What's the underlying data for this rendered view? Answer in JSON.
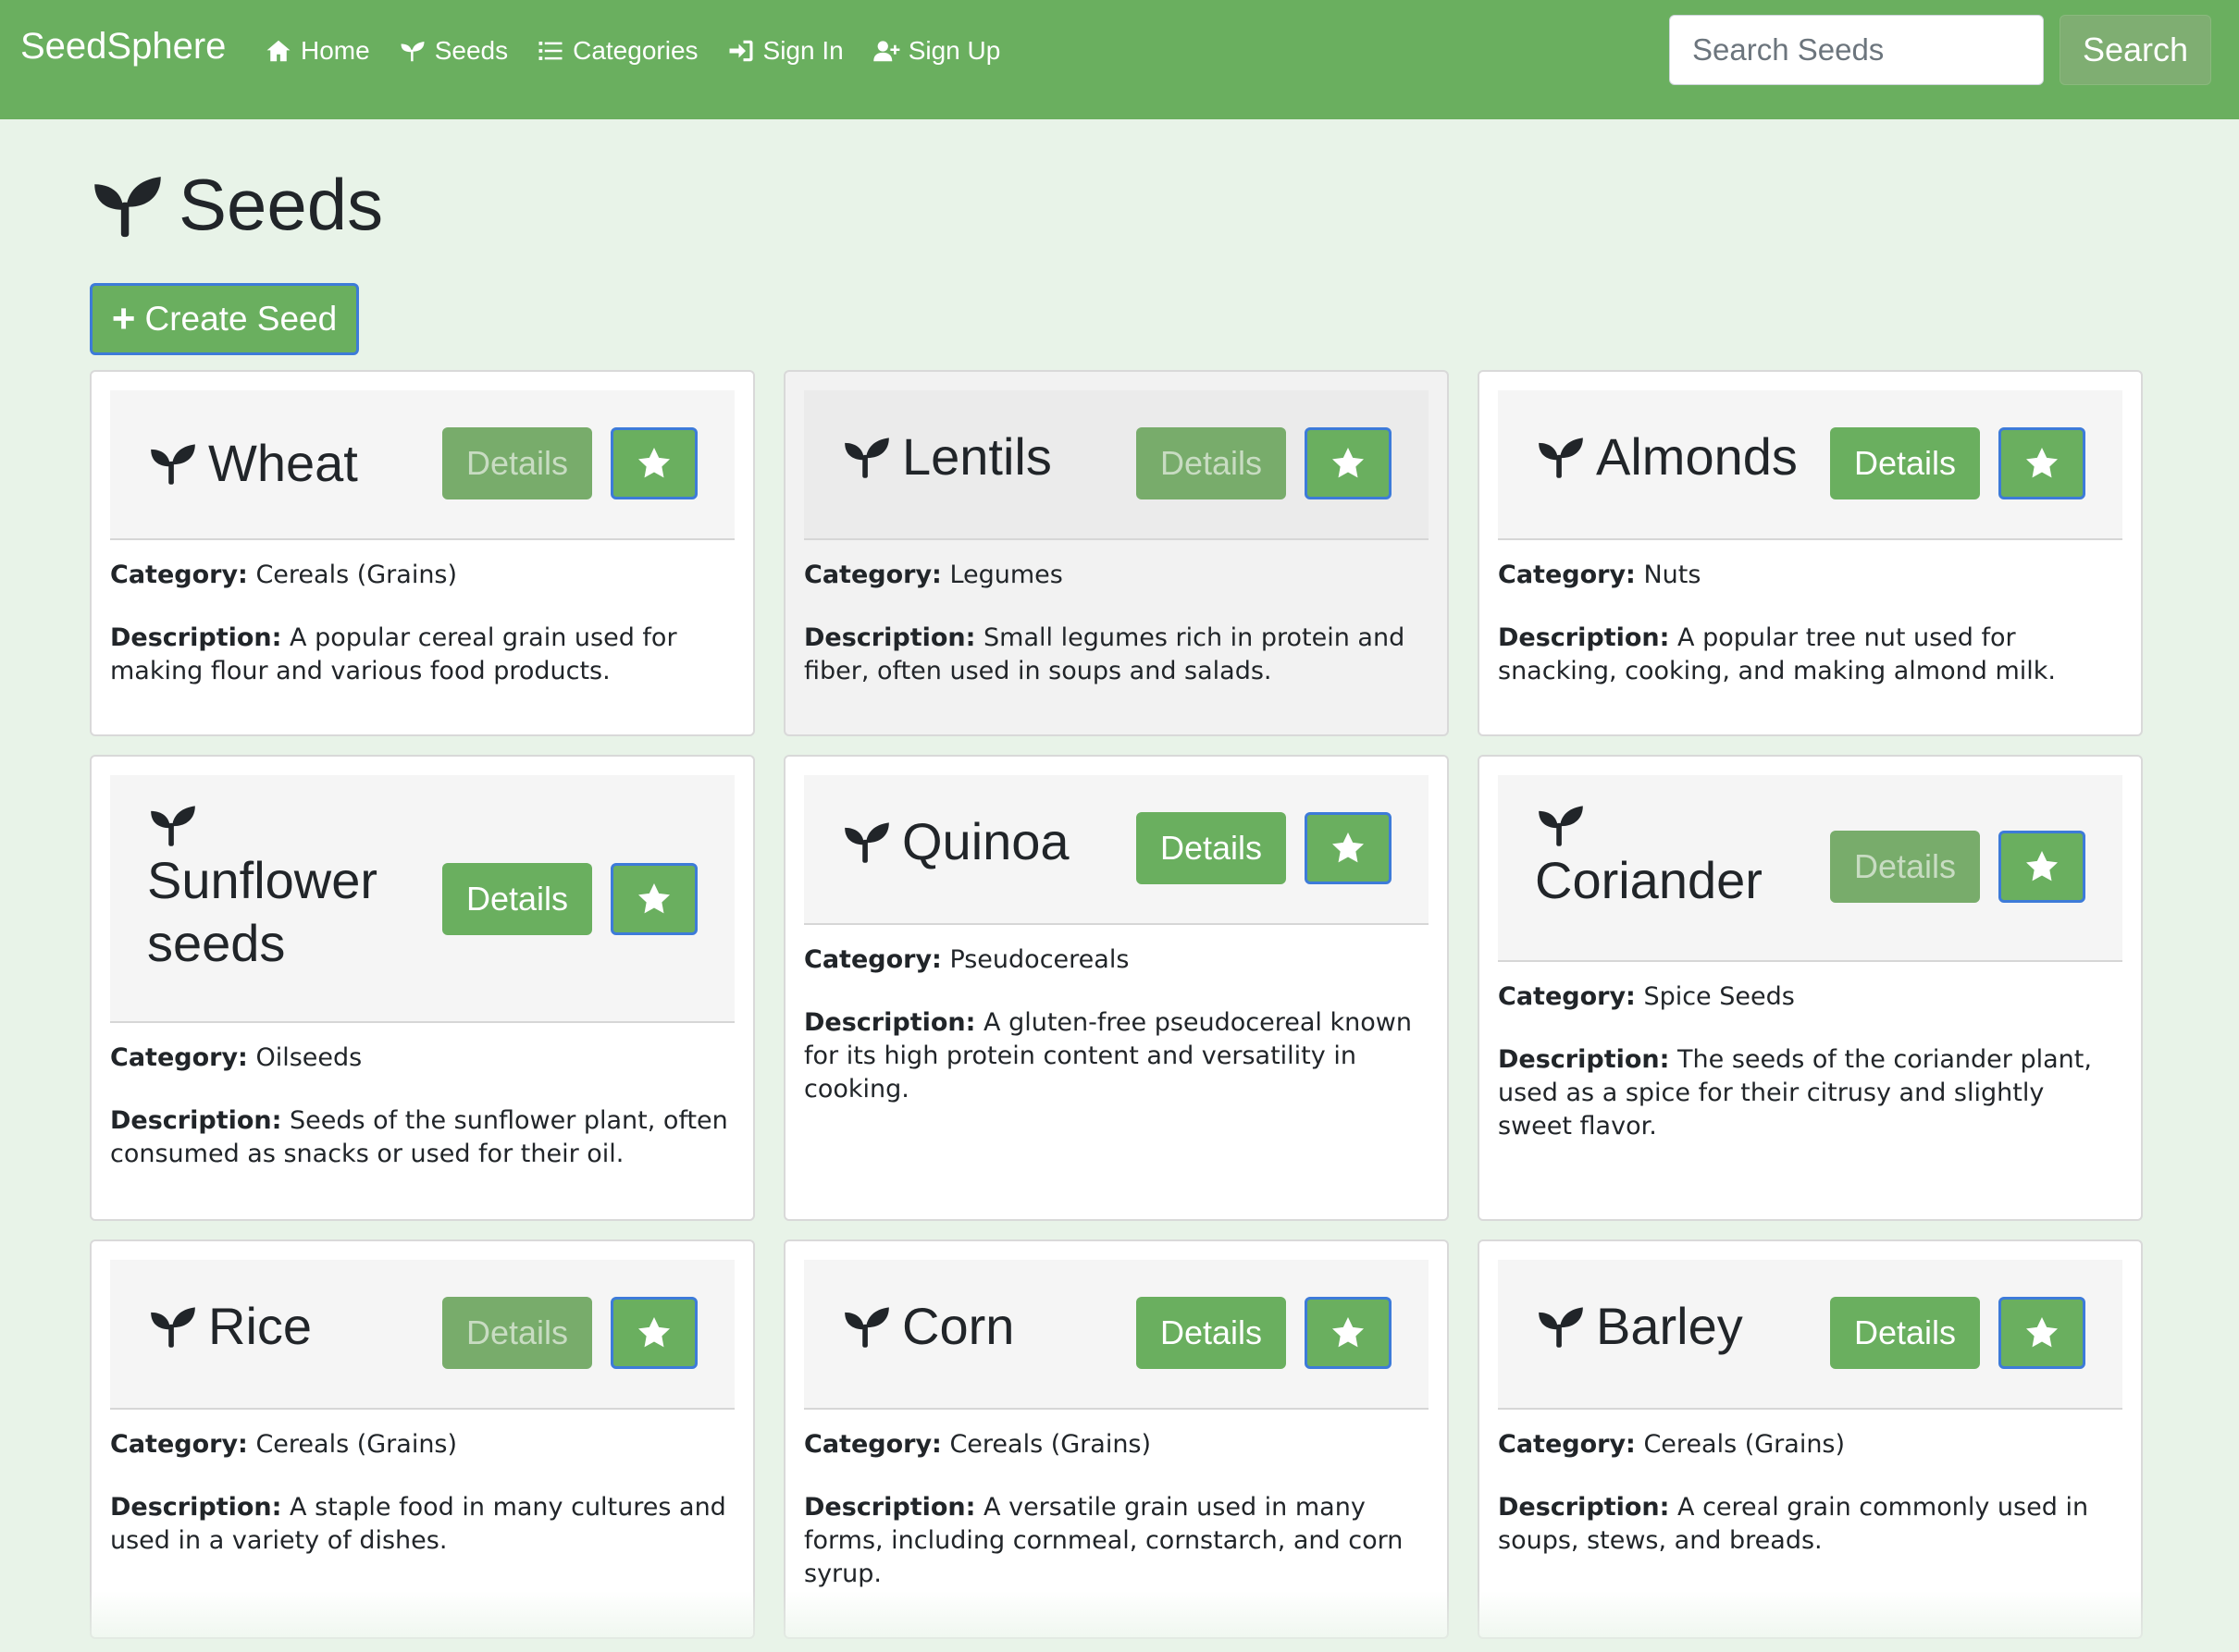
{
  "navbar": {
    "brand": "SeedSphere",
    "links": [
      {
        "label": "Home",
        "icon": "home-icon"
      },
      {
        "label": "Seeds",
        "icon": "seedling-icon"
      },
      {
        "label": "Categories",
        "icon": "list-icon"
      },
      {
        "label": "Sign In",
        "icon": "sign-in-icon"
      },
      {
        "label": "Sign Up",
        "icon": "user-plus-icon"
      }
    ],
    "search_placeholder": "Search Seeds",
    "search_button": "Search"
  },
  "page": {
    "title": "Seeds",
    "title_icon": "seedling-icon",
    "create_button": "Create Seed"
  },
  "labels": {
    "category": "Category:",
    "description": "Description:",
    "details": "Details"
  },
  "colors": {
    "navbar": "#6aaf5f",
    "background": "#e8f3e8",
    "button": "#6aaf5f",
    "focus_border": "#3d7bd9"
  },
  "seeds": [
    {
      "name": "Wheat",
      "category": "Cereals (Grains)",
      "description": "A popular cereal grain used for making flour and various food products."
    },
    {
      "name": "Lentils",
      "category": "Legumes",
      "description": "Small legumes rich in protein and fiber, often used in soups and salads."
    },
    {
      "name": "Almonds",
      "category": "Nuts",
      "description": "A popular tree nut used for snacking, cooking, and making almond milk."
    },
    {
      "name": "Sunflower seeds",
      "category": "Oilseeds",
      "description": "Seeds of the sunflower plant, often consumed as snacks or used for their oil."
    },
    {
      "name": "Quinoa",
      "category": "Pseudocereals",
      "description": "A gluten-free pseudocereal known for its high protein content and versatility in cooking."
    },
    {
      "name": "Coriander",
      "category": "Spice Seeds",
      "description": "The seeds of the coriander plant, used as a spice for their citrusy and slightly sweet flavor."
    },
    {
      "name": "Rice",
      "category": "Cereals (Grains)",
      "description": "A staple food in many cultures and used in a variety of dishes."
    },
    {
      "name": "Corn",
      "category": "Cereals (Grains)",
      "description": "A versatile grain used in many forms, including cornmeal, cornstarch, and corn syrup."
    },
    {
      "name": "Barley",
      "category": "Cereals (Grains)",
      "description": "A cereal grain commonly used in soups, stews, and breads."
    }
  ]
}
